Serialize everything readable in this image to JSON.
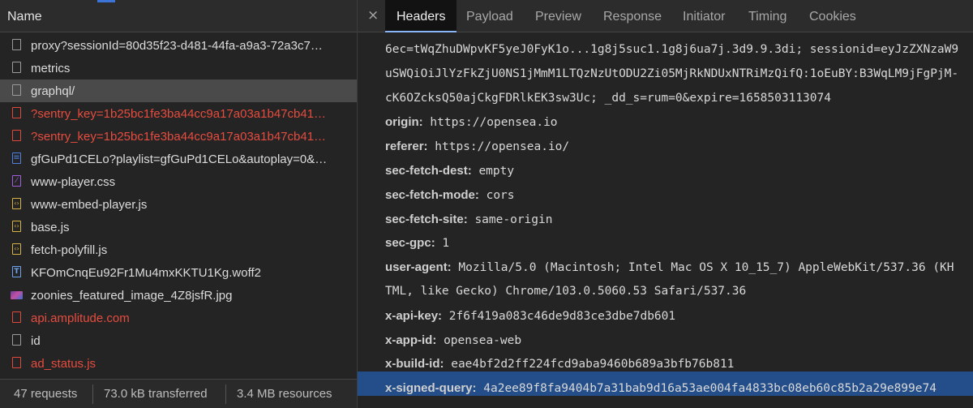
{
  "left_panel": {
    "name_header": "Name",
    "requests": [
      {
        "name": "proxy?sessionId=80d35f23-d481-44fa-a9a3-72a3c7…",
        "icon": "document-icon",
        "color": "default"
      },
      {
        "name": "metrics",
        "icon": "document-icon",
        "color": "default"
      },
      {
        "name": "graphql/",
        "icon": "document-icon",
        "color": "default",
        "selected": true
      },
      {
        "name": "?sentry_key=1b25bc1fe3ba44cc9a17a03a1b47cb41…",
        "icon": "document-icon",
        "color": "#e64c3f"
      },
      {
        "name": "?sentry_key=1b25bc1fe3ba44cc9a17a03a1b47cb41…",
        "icon": "document-icon",
        "color": "#e64c3f"
      },
      {
        "name": "gfGuPd1CELo?playlist=gfGuPd1CELo&autoplay=0&…",
        "icon": "html-doc-icon",
        "color": "default"
      },
      {
        "name": "www-player.css",
        "icon": "css-file-icon",
        "color": "default"
      },
      {
        "name": "www-embed-player.js",
        "icon": "js-file-icon",
        "color": "default"
      },
      {
        "name": "base.js",
        "icon": "js-file-icon",
        "color": "default"
      },
      {
        "name": "fetch-polyfill.js",
        "icon": "js-file-icon",
        "color": "default"
      },
      {
        "name": "KFOmCnqEu92Fr1Mu4mxKKTU1Kg.woff2",
        "icon": "font-file-icon",
        "color": "default"
      },
      {
        "name": "zoonies_featured_image_4Z8jsfR.jpg",
        "icon": "image-file-icon",
        "color": "default"
      },
      {
        "name": "api.amplitude.com",
        "icon": "document-icon",
        "color": "#e64c3f"
      },
      {
        "name": "id",
        "icon": "document-icon",
        "color": "default"
      },
      {
        "name": "ad_status.js",
        "icon": "document-icon",
        "color": "#e64c3f"
      }
    ],
    "footer": {
      "requests": "47 requests",
      "transferred": "73.0 kB transferred",
      "resources": "3.4 MB resources"
    }
  },
  "right_panel": {
    "close_label": "×",
    "tabs": [
      "Headers",
      "Payload",
      "Preview",
      "Response",
      "Initiator",
      "Timing",
      "Cookies"
    ],
    "active_tab": "Headers",
    "continuation_lines": [
      "6ec=tWqZhuDWpvKF5yeJ0FyK1o...1g8j5suc1.1g8j6ua7j.3d9.9.3di; sessionid=eyJzZXNzaW9",
      "uSWQiOiJlYzFkZjU0NS1jMmM1LTQzNzUtODU2Zi05MjRkNDUxNTRiMzQifQ:1oEuBY:B3WqLM9jFgPjM-",
      "cK6OZcksQ50ajCkgFDRlkEK3sw3Uc; _dd_s=rum=0&expire=1658503113074"
    ],
    "headers": [
      {
        "key": "origin:",
        "value": "https://opensea.io"
      },
      {
        "key": "referer:",
        "value": "https://opensea.io/"
      },
      {
        "key": "sec-fetch-dest:",
        "value": "empty"
      },
      {
        "key": "sec-fetch-mode:",
        "value": "cors"
      },
      {
        "key": "sec-fetch-site:",
        "value": "same-origin"
      },
      {
        "key": "sec-gpc:",
        "value": "1"
      },
      {
        "key": "user-agent:",
        "value": "Mozilla/5.0 (Macintosh; Intel Mac OS X 10_15_7) AppleWebKit/537.36 (KH"
      },
      {
        "key": "",
        "value": "TML, like Gecko) Chrome/103.0.5060.53 Safari/537.36"
      },
      {
        "key": "x-api-key:",
        "value": "2f6f419a083c46de9d83ce3dbe7db601"
      },
      {
        "key": "x-app-id:",
        "value": "opensea-web"
      },
      {
        "key": "x-build-id:",
        "value": "eae4bf2d2ff224fcd9aba9460b689a3bfb76b811"
      },
      {
        "key": "x-signed-query:",
        "value": "4a2ee89f8fa9404b7a31bab9d16a53ae004fa4833bc08eb60c85b2a29e899e74",
        "selected": true
      }
    ]
  }
}
